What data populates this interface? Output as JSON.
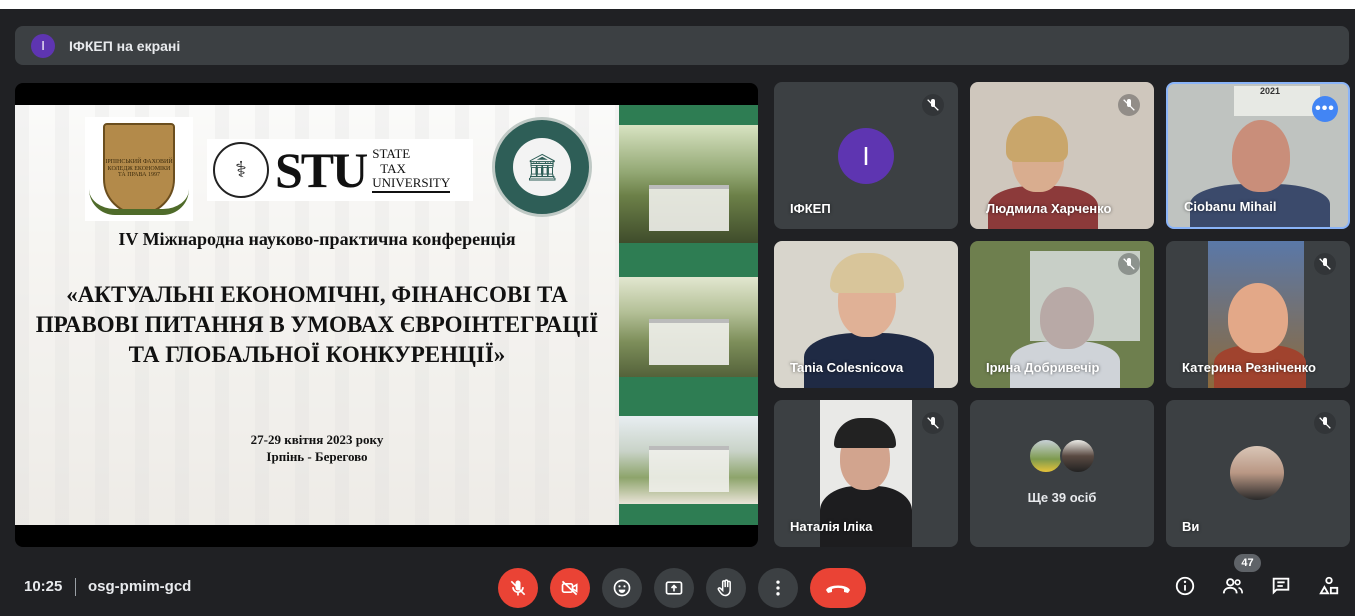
{
  "banner": {
    "avatar_letter": "І",
    "text": "ІФКЕП на екрані"
  },
  "slide": {
    "logo_college": "ІРПІНСЬКИЙ ФАХОВИЙ КОЛЕДЖ ЕКОНОМІКИ ТА ПРАВА 1997",
    "logo_stu_big": "STU",
    "logo_stu_lines": [
      "STATE",
      "TAX",
      "UNIVERSITY"
    ],
    "logo_dpu": "ДЕРЖАВНИЙ УНІВЕРСИТЕТ ФІНАНСІВ ТА ЦИФРОВИХ ТЕХНОЛОГІЙ ДПУ 1996",
    "conference": "IV Міжнародна науково-практична конференція",
    "title": "«АКТУАЛЬНІ ЕКОНОМІЧНІ, ФІНАНСОВІ ТА ПРАВОВІ ПИТАННЯ В УМОВАХ ЄВРОІНТЕГРАЦІЇ ТА ГЛОБАЛЬНОЇ КОНКУРЕНЦІЇ»",
    "date": "27-29 квітня 2023 року",
    "place": "Ірпінь - Берегово"
  },
  "participants": [
    {
      "name": "ІФКЕП",
      "avatar_letter": "І",
      "muted": true
    },
    {
      "name": "Людмила Харченко",
      "muted": true
    },
    {
      "name": "Ciobanu Mihail",
      "muted": false,
      "speaking": true,
      "overlay_year": "2021"
    },
    {
      "name": "Tania Colesnicova",
      "muted": false
    },
    {
      "name": "Ірина Добривечір",
      "muted": true
    },
    {
      "name": "Катерина Резніченко",
      "muted": true
    },
    {
      "name": "Наталія Іліка",
      "muted": true
    },
    {
      "name": "Ще 39 осіб",
      "muted": false
    },
    {
      "name": "Ви",
      "muted": true
    }
  ],
  "bottom": {
    "time": "10:25",
    "meeting_code": "osg-pmim-gcd",
    "participants_count": "47",
    "controls": [
      "mic-off-icon",
      "camera-off-icon",
      "emoji-icon",
      "present-icon",
      "raise-hand-icon",
      "more-options-icon",
      "end-call-icon"
    ],
    "right_icons": [
      "info-icon",
      "people-icon",
      "chat-icon",
      "activities-icon"
    ]
  },
  "colors": {
    "background": "#202124",
    "tile": "#3c4043",
    "red": "#ea4335",
    "accent": "#4285f4",
    "avatar": "#5e35b1",
    "slide_green": "#2e7d53"
  }
}
